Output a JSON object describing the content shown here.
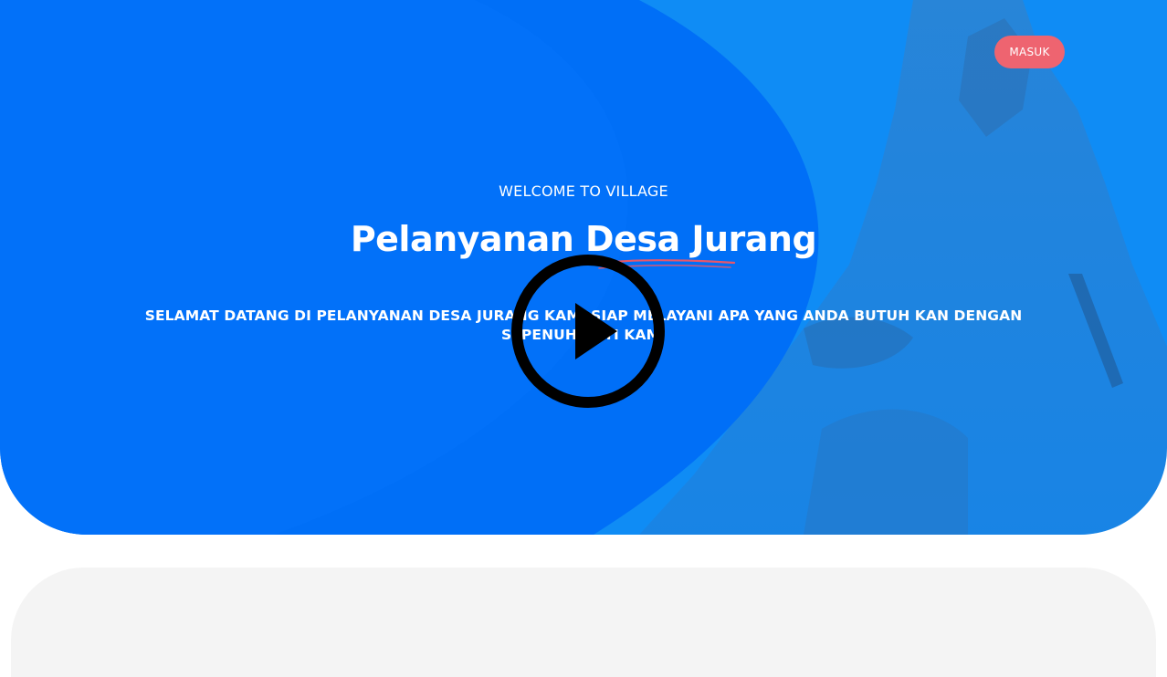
{
  "header": {
    "login_label": "MASUK"
  },
  "hero": {
    "tagline": "WELCOME TO VILLAGE",
    "title": "Pelanyanan Desa Jurang",
    "subtitle": "SELAMAT DATANG DI PELANYANAN DESA JURANG KAMI SIAP MELAYANI APA YANG ANDA BUTUH KAN DENGAN SEPENUH HATI KAMI"
  },
  "video": {
    "icon": "play-icon"
  },
  "colors": {
    "hero_blue": "#0f8cf5",
    "hero_blue_dark": "#006ff7",
    "button_coral": "#ee6470",
    "underline_red": "#e8576a",
    "lower_panel": "#f4f4f4"
  }
}
